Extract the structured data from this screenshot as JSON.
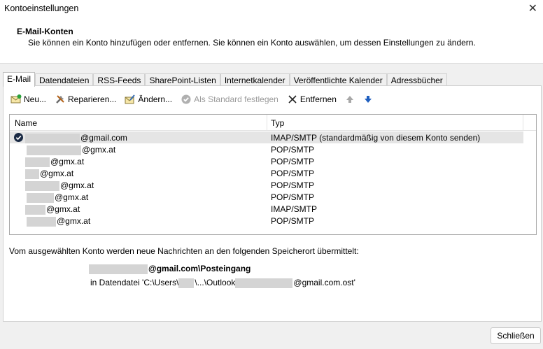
{
  "window": {
    "title": "Kontoeinstellungen",
    "close_symbol": "✕"
  },
  "header": {
    "title": "E-Mail-Konten",
    "description": "Sie können ein Konto hinzufügen oder entfernen. Sie können ein Konto auswählen, um dessen Einstellungen zu ändern."
  },
  "tabs": [
    "E-Mail",
    "Datendateien",
    "RSS-Feeds",
    "SharePoint-Listen",
    "Internetkalender",
    "Veröffentlichte Kalender",
    "Adressbücher"
  ],
  "toolbar": {
    "new": "Neu...",
    "repair": "Reparieren...",
    "change": "Ändern...",
    "set_default": "Als Standard festlegen",
    "remove": "Entfernen"
  },
  "list": {
    "col_name": "Name",
    "col_type": "Typ",
    "rows": [
      {
        "name": "@gmail.com",
        "type": "IMAP/SMTP (standardmäßig von diesem Konto senden)"
      },
      {
        "name": "@gmx.at",
        "type": "POP/SMTP"
      },
      {
        "name": "@gmx.at",
        "type": "POP/SMTP"
      },
      {
        "name": "@gmx.at",
        "type": "POP/SMTP"
      },
      {
        "name": "@gmx.at",
        "type": "POP/SMTP"
      },
      {
        "name": "@gmx.at",
        "type": "POP/SMTP"
      },
      {
        "name": "@gmx.at",
        "type": "IMAP/SMTP"
      },
      {
        "name": "@gmx.at",
        "type": "POP/SMTP"
      }
    ]
  },
  "delivery": {
    "info": "Vom ausgewählten Konto werden neue Nachrichten an den folgenden Speicherort übermittelt:",
    "folder": "@gmail.com\\Posteingang",
    "datafile_prefix": "in Datendatei 'C:\\Users\\",
    "datafile_middle": "\\...\\Outlook",
    "datafile_suffix": "@gmail.com.ost'"
  },
  "footer": {
    "close_label": "Schließen"
  },
  "colors": {
    "accent": "#1f5fbf",
    "selection": "#e5e5e5",
    "redaction": "#d4d4d4"
  }
}
